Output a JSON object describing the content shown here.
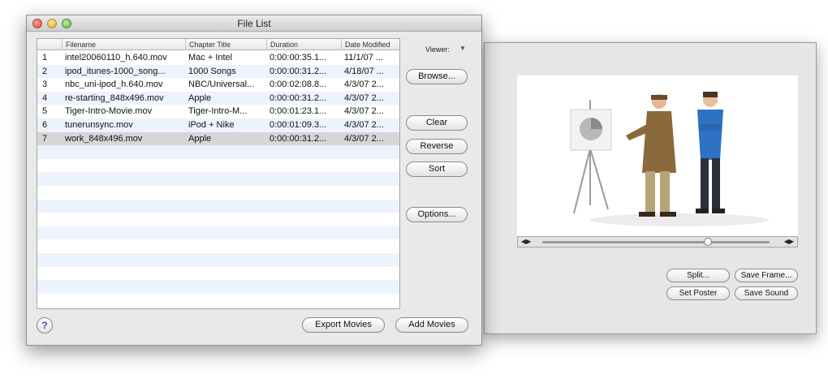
{
  "file_list_window": {
    "title": "File List",
    "table": {
      "columns": [
        "Filename",
        "Chapter Title",
        "Duration",
        "Date Modified"
      ],
      "rows": [
        {
          "num": "1",
          "filename": "intel20060110_h.640.mov",
          "chapter": "Mac + Intel",
          "duration": "0:00:00:35.1...",
          "date": "11/1/07 ..."
        },
        {
          "num": "2",
          "filename": "ipod_itunes-1000_song...",
          "chapter": "1000 Songs",
          "duration": "0:00:00:31.2...",
          "date": "4/18/07 ..."
        },
        {
          "num": "3",
          "filename": "nbc_uni-ipod_h.640.mov",
          "chapter": "NBC/Universal...",
          "duration": "0:00:02:08.8...",
          "date": "4/3/07 2..."
        },
        {
          "num": "4",
          "filename": "re-starting_848x496.mov",
          "chapter": "Apple",
          "duration": "0:00:00:31.2...",
          "date": "4/3/07 2..."
        },
        {
          "num": "5",
          "filename": "Tiger-Intro-Movie.mov",
          "chapter": "Tiger-Intro-M...",
          "duration": "0:00:01:23.1...",
          "date": "4/3/07 2..."
        },
        {
          "num": "6",
          "filename": "tunerunsync.mov",
          "chapter": "iPod + Nike",
          "duration": "0:00:01:09.3...",
          "date": "4/3/07 2..."
        },
        {
          "num": "7",
          "filename": "work_848x496.mov",
          "chapter": "Apple",
          "duration": "0:00:00:31.2...",
          "date": "4/3/07 2..."
        }
      ]
    },
    "viewer_label": "Viewer:",
    "buttons": {
      "browse": "Browse...",
      "clear": "Clear",
      "reverse": "Reverse",
      "sort": "Sort",
      "options": "Options...",
      "export_movies": "Export Movies",
      "add_movies": "Add Movies"
    },
    "help_label": "?"
  },
  "viewer_window": {
    "buttons": {
      "split": "Split...",
      "save_frame": "Save Frame...",
      "set_poster": "Set Poster",
      "save_sound": "Save Sound"
    },
    "playhead_fraction": 0.73
  },
  "colors": {
    "alt_row": "#edf3fc",
    "selected_row": "#d6d6d6",
    "help_text": "#6a3aa6"
  }
}
